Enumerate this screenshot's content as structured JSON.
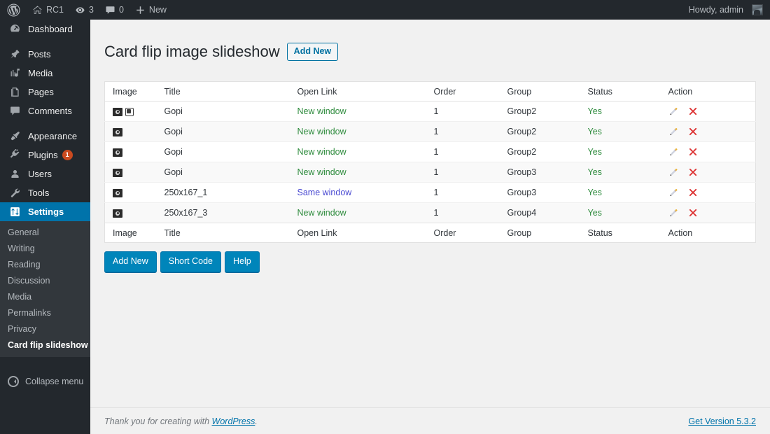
{
  "adminbar": {
    "logo_icon": "wordpress-logo-icon",
    "items": [
      {
        "icon": "home-icon",
        "label": "RC1"
      },
      {
        "icon": "updates-icon",
        "label": "3"
      },
      {
        "icon": "comment-icon",
        "label": "0"
      },
      {
        "icon": "plus-icon",
        "label": "New"
      }
    ],
    "account": "Howdy, admin",
    "avatar_icon": "user-avatar"
  },
  "sidebar": {
    "items": [
      {
        "icon": "dashboard-icon",
        "label": "Dashboard",
        "badge": "",
        "current": false
      },
      {
        "icon": "posts-pin-icon",
        "label": "Posts",
        "badge": "",
        "current": false
      },
      {
        "icon": "media-icon",
        "label": "Media",
        "badge": "",
        "current": false
      },
      {
        "icon": "pages-icon",
        "label": "Pages",
        "badge": "",
        "current": false
      },
      {
        "icon": "comments-icon",
        "label": "Comments",
        "badge": "",
        "current": false
      },
      {
        "icon": "appearance-brush-icon",
        "label": "Appearance",
        "badge": "",
        "current": false
      },
      {
        "icon": "plugins-plug-icon",
        "label": "Plugins",
        "badge": "1",
        "current": false
      },
      {
        "icon": "users-icon",
        "label": "Users",
        "badge": "",
        "current": false
      },
      {
        "icon": "tools-wrench-icon",
        "label": "Tools",
        "badge": "",
        "current": false
      },
      {
        "icon": "settings-icon",
        "label": "Settings",
        "badge": "",
        "current": true
      }
    ],
    "submenu": [
      {
        "label": "General",
        "current": false
      },
      {
        "label": "Writing",
        "current": false
      },
      {
        "label": "Reading",
        "current": false
      },
      {
        "label": "Discussion",
        "current": false
      },
      {
        "label": "Media",
        "current": false
      },
      {
        "label": "Permalinks",
        "current": false
      },
      {
        "label": "Privacy",
        "current": false
      },
      {
        "label": "Card flip slideshow",
        "current": true
      }
    ],
    "collapse_label": "Collapse menu",
    "collapse_icon": "collapse-arrow-icon"
  },
  "page": {
    "title": "Card flip image slideshow",
    "add_new_label": "Add New"
  },
  "table": {
    "headers": [
      "Image",
      "Title",
      "Open Link",
      "Order",
      "Group",
      "Status",
      "Action"
    ],
    "footers": [
      "Image",
      "Title",
      "Open Link",
      "Order",
      "Group",
      "Status",
      "Action"
    ],
    "rows": [
      {
        "image_icons": [
          "broken-image-icon",
          "broken-document-icon"
        ],
        "title": "Gopi",
        "open_link": "New window",
        "link_kind": "new",
        "order": "1",
        "group": "Group2",
        "status": "Yes"
      },
      {
        "image_icons": [
          "broken-image-icon"
        ],
        "title": "Gopi",
        "open_link": "New window",
        "link_kind": "new",
        "order": "1",
        "group": "Group2",
        "status": "Yes"
      },
      {
        "image_icons": [
          "broken-image-icon"
        ],
        "title": "Gopi",
        "open_link": "New window",
        "link_kind": "new",
        "order": "1",
        "group": "Group2",
        "status": "Yes"
      },
      {
        "image_icons": [
          "broken-image-icon"
        ],
        "title": "Gopi",
        "open_link": "New window",
        "link_kind": "new",
        "order": "1",
        "group": "Group3",
        "status": "Yes"
      },
      {
        "image_icons": [
          "broken-image-icon"
        ],
        "title": "250x167_1",
        "open_link": "Same window",
        "link_kind": "same",
        "order": "1",
        "group": "Group3",
        "status": "Yes"
      },
      {
        "image_icons": [
          "broken-image-icon"
        ],
        "title": "250x167_3",
        "open_link": "New window",
        "link_kind": "new",
        "order": "1",
        "group": "Group4",
        "status": "Yes"
      }
    ],
    "action_icons": [
      "edit-pencil-icon",
      "delete-x-icon"
    ]
  },
  "buttons": [
    {
      "label": "Add New"
    },
    {
      "label": "Short Code"
    },
    {
      "label": "Help"
    }
  ],
  "footer": {
    "thanks_prefix": "Thank you for creating with ",
    "wordpress_link": "WordPress",
    "thanks_suffix": ".",
    "version": "Get Version 5.3.2"
  },
  "colors": {
    "admin_bg": "#23282d",
    "submenu_bg": "#32373c",
    "accent_blue": "#0073aa",
    "button_blue": "#0085ba",
    "badge_orange": "#ca4a1f",
    "link_new_green": "#2e8b3d",
    "link_same_blue": "#4747d1",
    "content_bg": "#f1f1f1",
    "delete_red": "#dd3333"
  }
}
